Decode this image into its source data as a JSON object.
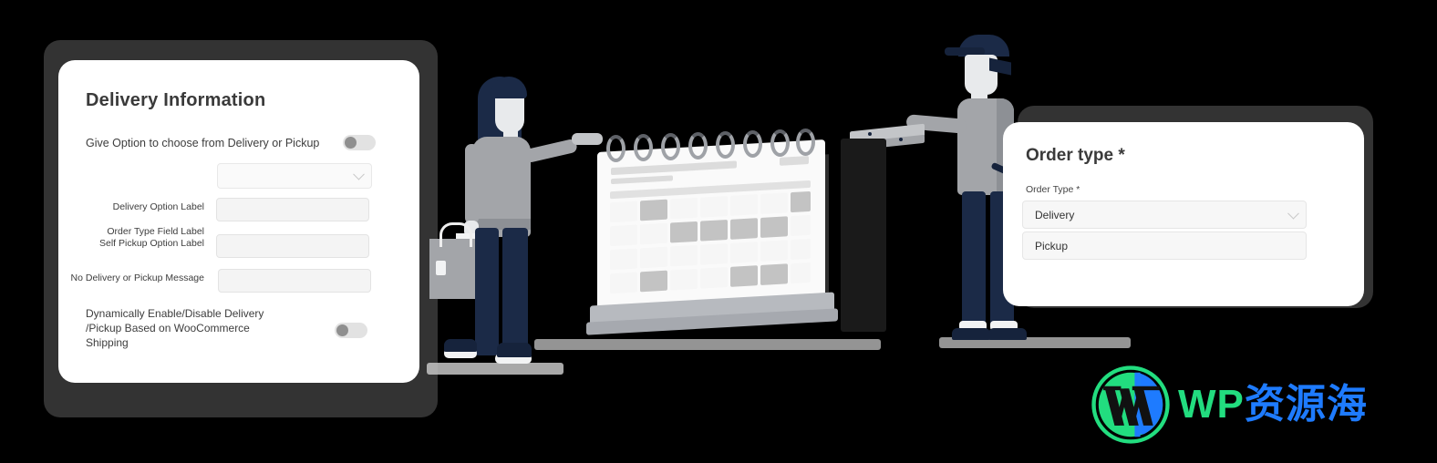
{
  "watermark": {
    "logo_icon": "wordpress-logo-icon",
    "text_en": "WP",
    "text_cn": "资源海"
  },
  "left_panel": {
    "title": "Delivery Information",
    "toggle_row": {
      "label": "Give Option to choose from Delivery or Pickup",
      "state": "off"
    },
    "fields": [
      {
        "label": "Order Type Field Label",
        "type": "select",
        "value": "",
        "icon": "chevron-down-icon"
      },
      {
        "label": "Delivery Option Label",
        "type": "text",
        "value": ""
      },
      {
        "label": "Self Pickup Option Label",
        "type": "text",
        "value": ""
      },
      {
        "label": "No Delivery or Pickup Message",
        "type": "text",
        "value": ""
      }
    ],
    "bottom_toggle": {
      "label": "Dynamically Enable/Disable Delivery /Pickup  Based on WooCommerce Shipping",
      "state": "off"
    }
  },
  "right_panel": {
    "title": "Order type *",
    "field_label": "Order Type *",
    "selected_value": "Delivery",
    "select_icon": "chevron-down-icon",
    "options": [
      {
        "label": "Delivery",
        "selected": true
      },
      {
        "label": "Pickup",
        "selected": false
      }
    ]
  },
  "illustration": {
    "shopper": "woman-with-shopping-bag",
    "calendar": "desk-calendar",
    "courier": "delivery-man-with-pizza-box"
  },
  "colors": {
    "background": "#000000",
    "backdrop": "#333333",
    "card": "#ffffff",
    "text": "#3a3a3a",
    "field_bg": "#f4f4f4",
    "navy": "#1b2a47",
    "gray": "#a3a5a9",
    "wm_green": "#22dd7f",
    "wm_blue": "#1e7bff"
  }
}
